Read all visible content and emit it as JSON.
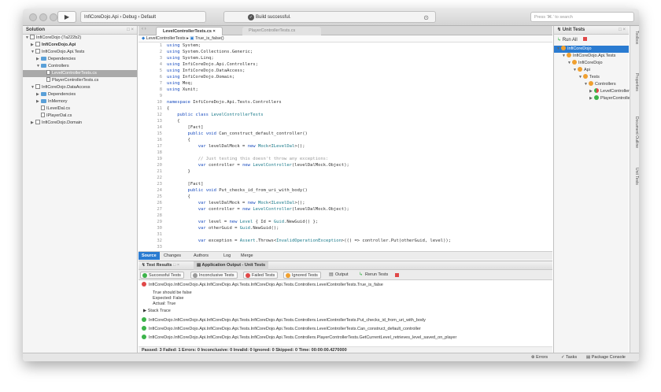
{
  "titlebar": {
    "crumb_project": "InfiCoreDojo.Api",
    "crumb_config": "Debug",
    "crumb_device": "Default",
    "status": "Build successful.",
    "search_placeholder": "Press '⌘.' to search",
    "run_glyph": "▶"
  },
  "solution": {
    "title": "Solution",
    "items": [
      {
        "label": "InfiCoreDojo (7a222b2)",
        "indent": 0,
        "kind": "sol",
        "open": true
      },
      {
        "label": "InfiCoreDojo.Api",
        "indent": 1,
        "kind": "proj",
        "open": false,
        "bold": true
      },
      {
        "label": "InfiCoreDojo.Api.Tests",
        "indent": 1,
        "kind": "proj",
        "open": true
      },
      {
        "label": "Dependencies",
        "indent": 2,
        "kind": "folder",
        "open": false
      },
      {
        "label": "Controllers",
        "indent": 2,
        "kind": "folder",
        "open": true
      },
      {
        "label": "LevelControllerTests.cs",
        "indent": 3,
        "kind": "file",
        "selected": true
      },
      {
        "label": "PlayerControllerTests.cs",
        "indent": 3,
        "kind": "file"
      },
      {
        "label": "InfiCoreDojo.DataAccess",
        "indent": 1,
        "kind": "proj",
        "open": true
      },
      {
        "label": "Dependencies",
        "indent": 2,
        "kind": "folder",
        "open": false
      },
      {
        "label": "InMemory",
        "indent": 2,
        "kind": "folder",
        "open": false
      },
      {
        "label": "ILevelDal.cs",
        "indent": 2,
        "kind": "file"
      },
      {
        "label": "IPlayerDal.cs",
        "indent": 2,
        "kind": "file"
      },
      {
        "label": "InfiCoreDojo.Domain",
        "indent": 1,
        "kind": "proj",
        "open": false
      }
    ]
  },
  "editor": {
    "tab_active": "LevelControllerTests.cs",
    "tab_inactive": "PlayerControllerTests.cs",
    "path_class": "LevelControllerTests",
    "path_method": "True_is_false()",
    "lines": [
      [
        "1",
        "using System;"
      ],
      [
        "2",
        "using System.Collections.Generic;"
      ],
      [
        "3",
        "using System.Linq;"
      ],
      [
        "4",
        "using InfiCoreDojo.Api.Controllers;"
      ],
      [
        "5",
        "using InfiCoreDojo.DataAccess;"
      ],
      [
        "6",
        "using InfiCoreDojo.Domain;"
      ],
      [
        "7",
        "using Moq;"
      ],
      [
        "8",
        "using Xunit;"
      ],
      [
        "9",
        ""
      ],
      [
        "10",
        "namespace InfiCoreDojo.Api.Tests.Controllers"
      ],
      [
        "11",
        "{"
      ],
      [
        "12",
        "    public class LevelControllerTests"
      ],
      [
        "13",
        "    {"
      ],
      [
        "14",
        "        [Fact]"
      ],
      [
        "15",
        "        public void Can_construct_default_controller()"
      ],
      [
        "16",
        "        {"
      ],
      [
        "17",
        "            var levelDalMock = new Mock<ILevelDal>();"
      ],
      [
        "18",
        ""
      ],
      [
        "19",
        "            // Just testing this doesn't throw any exceptions:"
      ],
      [
        "20",
        "            var controller = new LevelController(levelDalMock.Object);"
      ],
      [
        "21",
        "        }"
      ],
      [
        "22",
        ""
      ],
      [
        "23",
        "        [Fact]"
      ],
      [
        "24",
        "        public void Put_checks_id_from_uri_with_body()"
      ],
      [
        "25",
        "        {"
      ],
      [
        "26",
        "            var levelDalMock = new Mock<ILevelDal>();"
      ],
      [
        "27",
        "            var controller = new LevelController(levelDalMock.Object);"
      ],
      [
        "28",
        ""
      ],
      [
        "29",
        "            var level = new Level { Id = Guid.NewGuid() };"
      ],
      [
        "30",
        "            var otherGuid = Guid.NewGuid();"
      ],
      [
        "31",
        ""
      ],
      [
        "32",
        "            var exception = Assert.Throws<InvalidOperationException>(() => controller.Put(otherGuid, level));"
      ],
      [
        "33",
        ""
      ]
    ],
    "bottom_tabs": [
      "Source",
      "Changes",
      "Authors",
      "Log",
      "Merge"
    ]
  },
  "tests": {
    "tab1": "Test Results",
    "tab2": "Application Output - Unit Tests",
    "buttons": [
      "Successful Tests",
      "Inconclusive Tests",
      "Failed Tests",
      "Ignored Tests",
      "Output",
      "Rerun Tests"
    ],
    "failed": "InfiCoreDojo.InfiCoreDojo.Api.InfiCoreDojo.Api.Tests.InfiCoreDojo.Api.Tests.Controllers.LevelControllerTests.True_is_false",
    "msg1": "True should be false",
    "msg2": "Expected: False",
    "msg3": "Actual:   True",
    "stack": "Stack Trace",
    "passed": [
      "InfiCoreDojo.InfiCoreDojo.Api.InfiCoreDojo.Api.Tests.InfiCoreDojo.Api.Tests.Controllers.LevelControllerTests.Put_checks_id_from_uri_with_body",
      "InfiCoreDojo.InfiCoreDojo.Api.InfiCoreDojo.Api.Tests.InfiCoreDojo.Api.Tests.Controllers.LevelControllerTests.Can_construct_default_controller",
      "InfiCoreDojo.InfiCoreDojo.Api.InfiCoreDojo.Api.Tests.InfiCoreDojo.Api.Tests.Controllers.PlayerControllerTests.GetCurrentLevel_retrieves_level_saved_on_player"
    ],
    "summary": "Passed: 3   Failed: 1   Errors: 0   Inconclusive: 0   Invalid: 0   Ignored: 0   Skipped: 0   Time: 00:00:00.4270000"
  },
  "unit": {
    "title": "Unit Tests",
    "run_all": "Run All",
    "items": [
      {
        "label": "InfiCoreDojo",
        "indent": 0,
        "selected": true
      },
      {
        "label": "InfiCoreDojo.Api.Tests",
        "indent": 1
      },
      {
        "label": "InfiCoreDojo",
        "indent": 2
      },
      {
        "label": "Api",
        "indent": 3
      },
      {
        "label": "Tests",
        "indent": 4
      },
      {
        "label": "Controllers",
        "indent": 5
      },
      {
        "label": "LevelControllerTe",
        "indent": 6,
        "status": "r"
      },
      {
        "label": "PlayerControllerT",
        "indent": 6,
        "status": "g"
      }
    ]
  },
  "side": {
    "toolbox": "Toolbox",
    "properties": "Properties",
    "outline": "Document Outline",
    "unit": "Unit Tests"
  },
  "bottombar": {
    "errors": "Errors",
    "tasks": "Tasks",
    "console": "Package Console"
  }
}
